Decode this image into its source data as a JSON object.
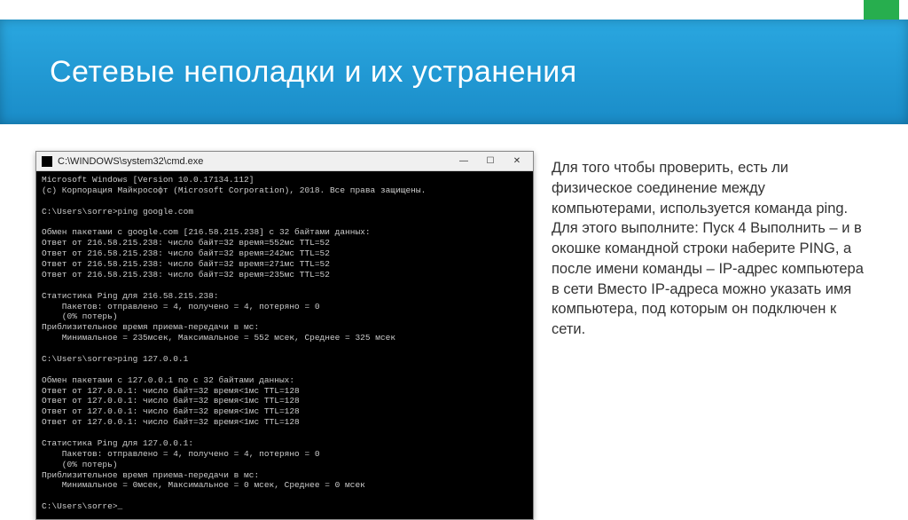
{
  "banner": {
    "title": "Сетевые неполадки и их устранения"
  },
  "desc": {
    "text": "Для того чтобы проверить, есть ли физическое соединение между компьютерами, используется команда ping. Для этого выполните: Пуск 4 Выполнить – и в окошке командной строки наберите PING, а после имени команды – IP-адрес компьютера в сети Вместо IP-адреса можно указать имя компьютера, под которым он подключен к сети."
  },
  "cmd": {
    "title": "C:\\WINDOWS\\system32\\cmd.exe",
    "btn_min": "—",
    "btn_max": "☐",
    "btn_close": "✕",
    "lines": [
      "Microsoft Windows [Version 10.0.17134.112]",
      "(c) Корпорация Майкрософт (Microsoft Corporation), 2018. Все права защищены.",
      "",
      "C:\\Users\\sorre>ping google.com",
      "",
      "Обмен пакетами с google.com [216.58.215.238] с 32 байтами данных:",
      "Ответ от 216.58.215.238: число байт=32 время=552мс TTL=52",
      "Ответ от 216.58.215.238: число байт=32 время=242мс TTL=52",
      "Ответ от 216.58.215.238: число байт=32 время=271мс TTL=52",
      "Ответ от 216.58.215.238: число байт=32 время=235мс TTL=52",
      "",
      "Статистика Ping для 216.58.215.238:",
      "    Пакетов: отправлено = 4, получено = 4, потеряно = 0",
      "    (0% потерь)",
      "Приблизительное время приема-передачи в мс:",
      "    Минимальное = 235мсек, Максимальное = 552 мсек, Среднее = 325 мсек",
      "",
      "C:\\Users\\sorre>ping 127.0.0.1",
      "",
      "Обмен пакетами с 127.0.0.1 по с 32 байтами данных:",
      "Ответ от 127.0.0.1: число байт=32 время<1мс TTL=128",
      "Ответ от 127.0.0.1: число байт=32 время<1мс TTL=128",
      "Ответ от 127.0.0.1: число байт=32 время<1мс TTL=128",
      "Ответ от 127.0.0.1: число байт=32 время<1мс TTL=128",
      "",
      "Статистика Ping для 127.0.0.1:",
      "    Пакетов: отправлено = 4, получено = 4, потеряно = 0",
      "    (0% потерь)",
      "Приблизительное время приема-передачи в мс:",
      "    Минимальное = 0мсек, Максимальное = 0 мсек, Среднее = 0 мсек",
      "",
      "C:\\Users\\sorre>_"
    ]
  }
}
